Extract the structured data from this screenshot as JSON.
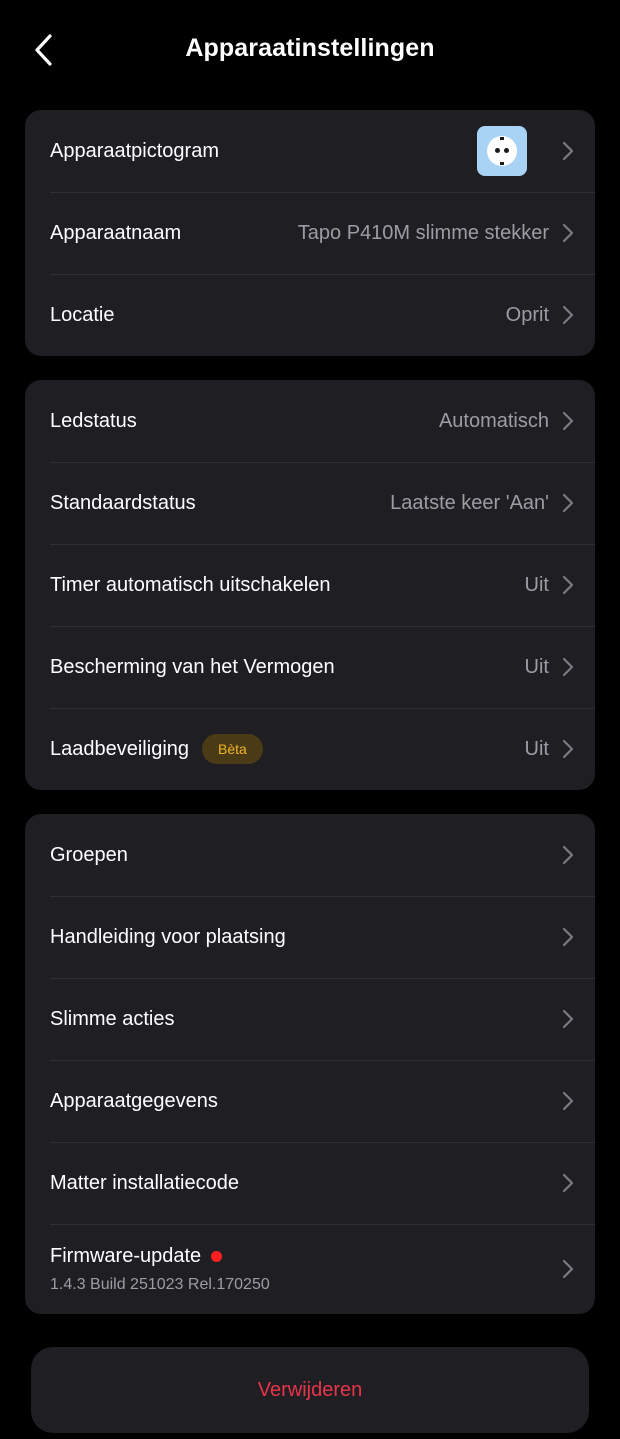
{
  "header": {
    "title": "Apparaatinstellingen"
  },
  "card1": {
    "items": [
      {
        "label": "Apparaatpictogram",
        "icon": "power-socket-icon"
      },
      {
        "label": "Apparaatnaam",
        "value": "Tapo P410M slimme stekker"
      },
      {
        "label": "Locatie",
        "value": "Oprit"
      }
    ]
  },
  "card2": {
    "items": [
      {
        "label": "Ledstatus",
        "value": "Automatisch"
      },
      {
        "label": "Standaardstatus",
        "value": "Laatste keer 'Aan'"
      },
      {
        "label": "Timer automatisch uitschakelen",
        "value": "Uit"
      },
      {
        "label": "Bescherming van het Vermogen",
        "value": "Uit"
      },
      {
        "label": "Laadbeveiliging",
        "badge": "Bèta",
        "value": "Uit"
      }
    ]
  },
  "card3": {
    "items": [
      {
        "label": "Groepen"
      },
      {
        "label": "Handleiding voor plaatsing"
      },
      {
        "label": "Slimme acties"
      },
      {
        "label": "Apparaatgegevens"
      },
      {
        "label": "Matter installatiecode"
      },
      {
        "label": "Firmware-update",
        "version": "1.4.3 Build 251023 Rel.170250"
      }
    ]
  },
  "footer": {
    "delete_label": "Verwijderen"
  },
  "colors": {
    "background": "#000000",
    "card": "#1f1f23",
    "secondary_text": "#9c9ca3",
    "delete_red": "#e8344a",
    "beta_text": "#f0b429",
    "update_dot": "#ff1f1f",
    "device_icon_bg": "#a9d3f5"
  }
}
